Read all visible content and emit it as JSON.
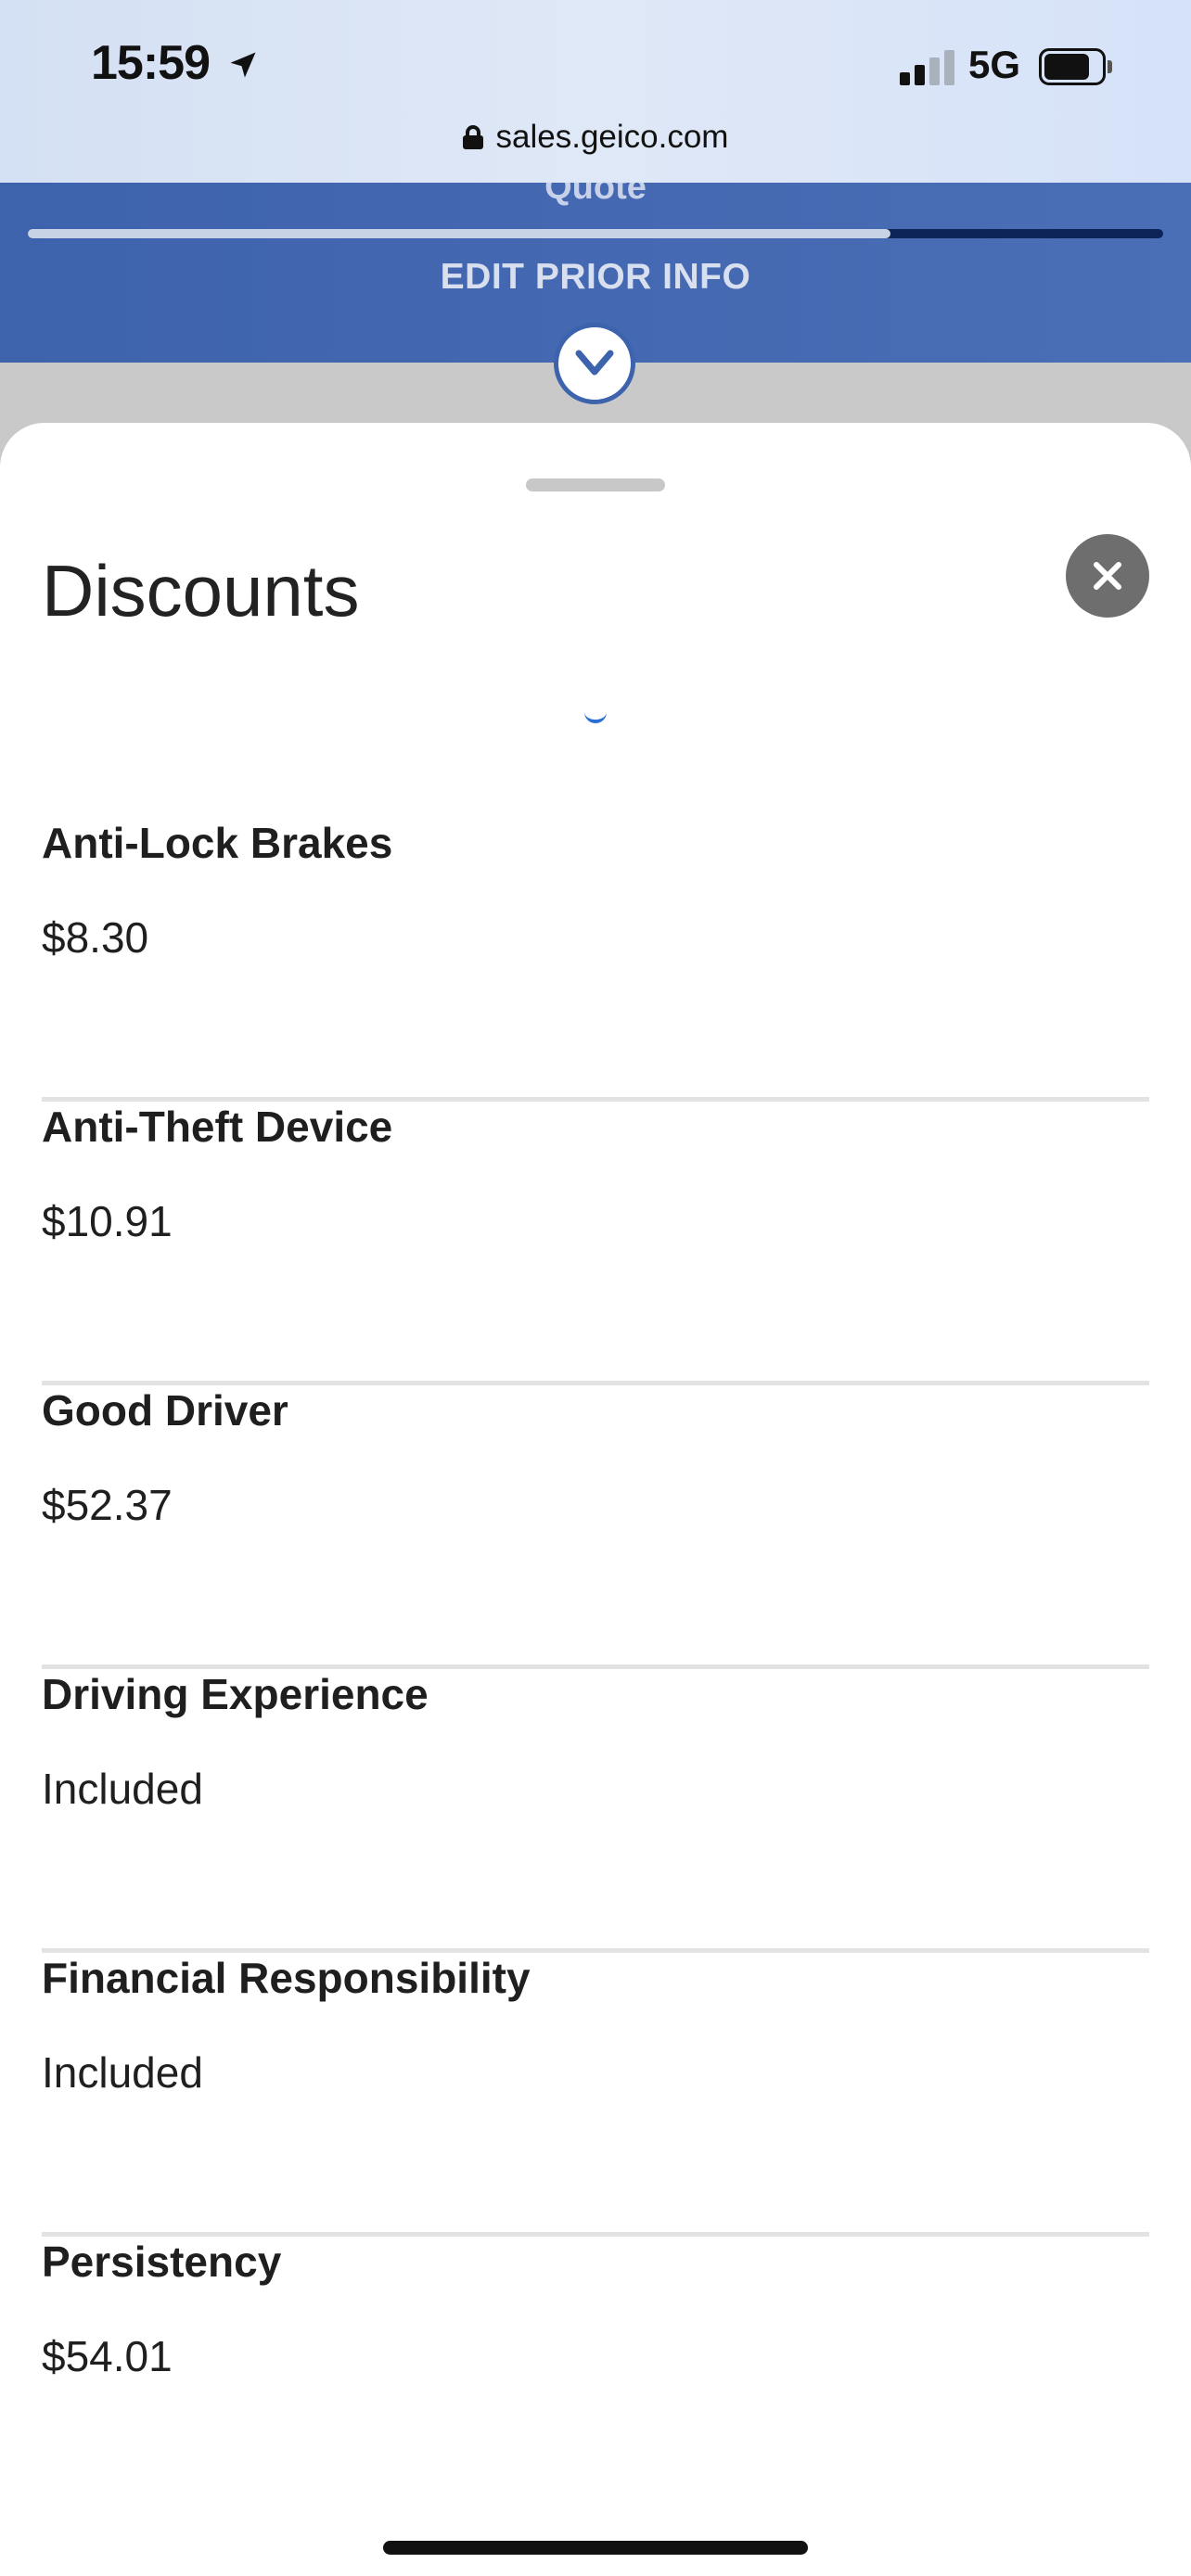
{
  "status_bar": {
    "time": "15:59",
    "network": "5G",
    "icons": [
      "location-arrow-icon",
      "signal-icon",
      "battery-icon"
    ]
  },
  "browser": {
    "url": "sales.geico.com",
    "lock_icon": "lock-icon"
  },
  "header": {
    "quote_label": "Quote",
    "progress_fraction": 0.76,
    "edit_prior_label": "EDIT PRIOR INFO",
    "chevron_icon": "chevron-down-circle-icon",
    "band_color": "#3e63ad",
    "progress_track_color": "#0d2459"
  },
  "sheet": {
    "title": "Discounts",
    "close_icon": "close-icon",
    "discounts": [
      {
        "name": "Anti-Lock Brakes",
        "value": "$8.30"
      },
      {
        "name": "Anti-Theft Device",
        "value": "$10.91"
      },
      {
        "name": "Good Driver",
        "value": "$52.37"
      },
      {
        "name": "Driving Experience",
        "value": "Included"
      },
      {
        "name": "Financial Responsibility",
        "value": "Included"
      },
      {
        "name": "Persistency",
        "value": "$54.01"
      }
    ]
  }
}
